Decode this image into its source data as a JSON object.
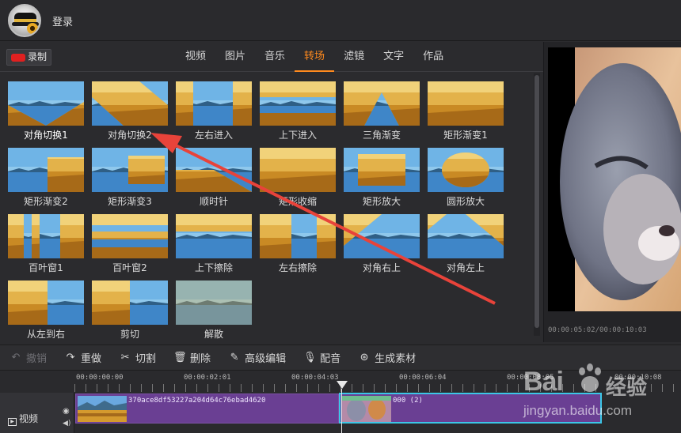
{
  "header": {
    "login_label": "登录"
  },
  "record": {
    "label": "录制",
    "icon": "record-icon",
    "color": "#e02020"
  },
  "tabs": [
    {
      "label": "视频",
      "active": false
    },
    {
      "label": "图片",
      "active": false
    },
    {
      "label": "音乐",
      "active": false
    },
    {
      "label": "转场",
      "active": true
    },
    {
      "label": "滤镜",
      "active": false
    },
    {
      "label": "文字",
      "active": false
    },
    {
      "label": "作品",
      "active": false
    }
  ],
  "accent_color": "#ff8a1e",
  "transitions": [
    {
      "label": "对角切换1",
      "highlight": true,
      "style": "diag"
    },
    {
      "label": "对角切换2",
      "highlight": false,
      "style": "diag2"
    },
    {
      "label": "左右进入",
      "highlight": false,
      "style": "lr"
    },
    {
      "label": "上下进入",
      "highlight": false,
      "style": "ud"
    },
    {
      "label": "三角渐变",
      "highlight": false,
      "style": "tri"
    },
    {
      "label": "矩形渐变1",
      "highlight": false,
      "style": "rect"
    },
    {
      "label": "矩形渐变2",
      "highlight": false,
      "style": "rect2"
    },
    {
      "label": "矩形渐变3",
      "highlight": false,
      "style": "rect3"
    },
    {
      "label": "顺时针",
      "highlight": false,
      "style": "clock"
    },
    {
      "label": "矩形收缩",
      "highlight": false,
      "style": "shrink"
    },
    {
      "label": "矩形放大",
      "highlight": false,
      "style": "grow"
    },
    {
      "label": "圆形放大",
      "highlight": false,
      "style": "circle"
    },
    {
      "label": "百叶窗1",
      "highlight": false,
      "style": "blinds"
    },
    {
      "label": "百叶窗2",
      "highlight": false,
      "style": "blinds2"
    },
    {
      "label": "上下擦除",
      "highlight": false,
      "style": "wipeud"
    },
    {
      "label": "左右擦除",
      "highlight": false,
      "style": "wipelr"
    },
    {
      "label": "对角右上",
      "highlight": false,
      "style": "tr"
    },
    {
      "label": "对角左上",
      "highlight": false,
      "style": "tl"
    },
    {
      "label": "从左到右",
      "highlight": false,
      "style": "l2r"
    },
    {
      "label": "剪切",
      "highlight": false,
      "style": "cut"
    },
    {
      "label": "解散",
      "highlight": false,
      "style": "dissolve"
    }
  ],
  "preview": {
    "timecode": "00:00:05:02/00:00:10:03"
  },
  "toolbar": [
    {
      "label": "撤销",
      "icon": "undo-icon",
      "glyph": "↶",
      "disabled": true
    },
    {
      "label": "重做",
      "icon": "redo-icon",
      "glyph": "↷",
      "disabled": false
    },
    {
      "label": "切割",
      "icon": "scissors-icon",
      "glyph": "✂",
      "disabled": false
    },
    {
      "label": "删除",
      "icon": "trash-icon",
      "glyph": "🗑",
      "disabled": false
    },
    {
      "label": "高级编辑",
      "icon": "pencil-icon",
      "glyph": "✎",
      "disabled": false
    },
    {
      "label": "配音",
      "icon": "microphone-icon",
      "glyph": "🎙",
      "disabled": false
    },
    {
      "label": "生成素材",
      "icon": "film-reel-icon",
      "glyph": "⊛",
      "disabled": false
    }
  ],
  "timeline": {
    "ticks": [
      "00:00:00:00",
      "00:00:02:01",
      "00:00:04:03",
      "00:00:06:04",
      "00:00:08:05",
      "00:00:10:08"
    ],
    "track_label": "视频",
    "clips": [
      {
        "name": "370ace8df53227a204d64c76ebad4620"
      },
      {
        "name": "000 (2)"
      }
    ],
    "clip_color": "#6a3f93",
    "selected_border": "#3cc6e6"
  },
  "watermark": {
    "brand": "Bai",
    "cn": "经验",
    "url": "jingyan.baidu.com"
  }
}
